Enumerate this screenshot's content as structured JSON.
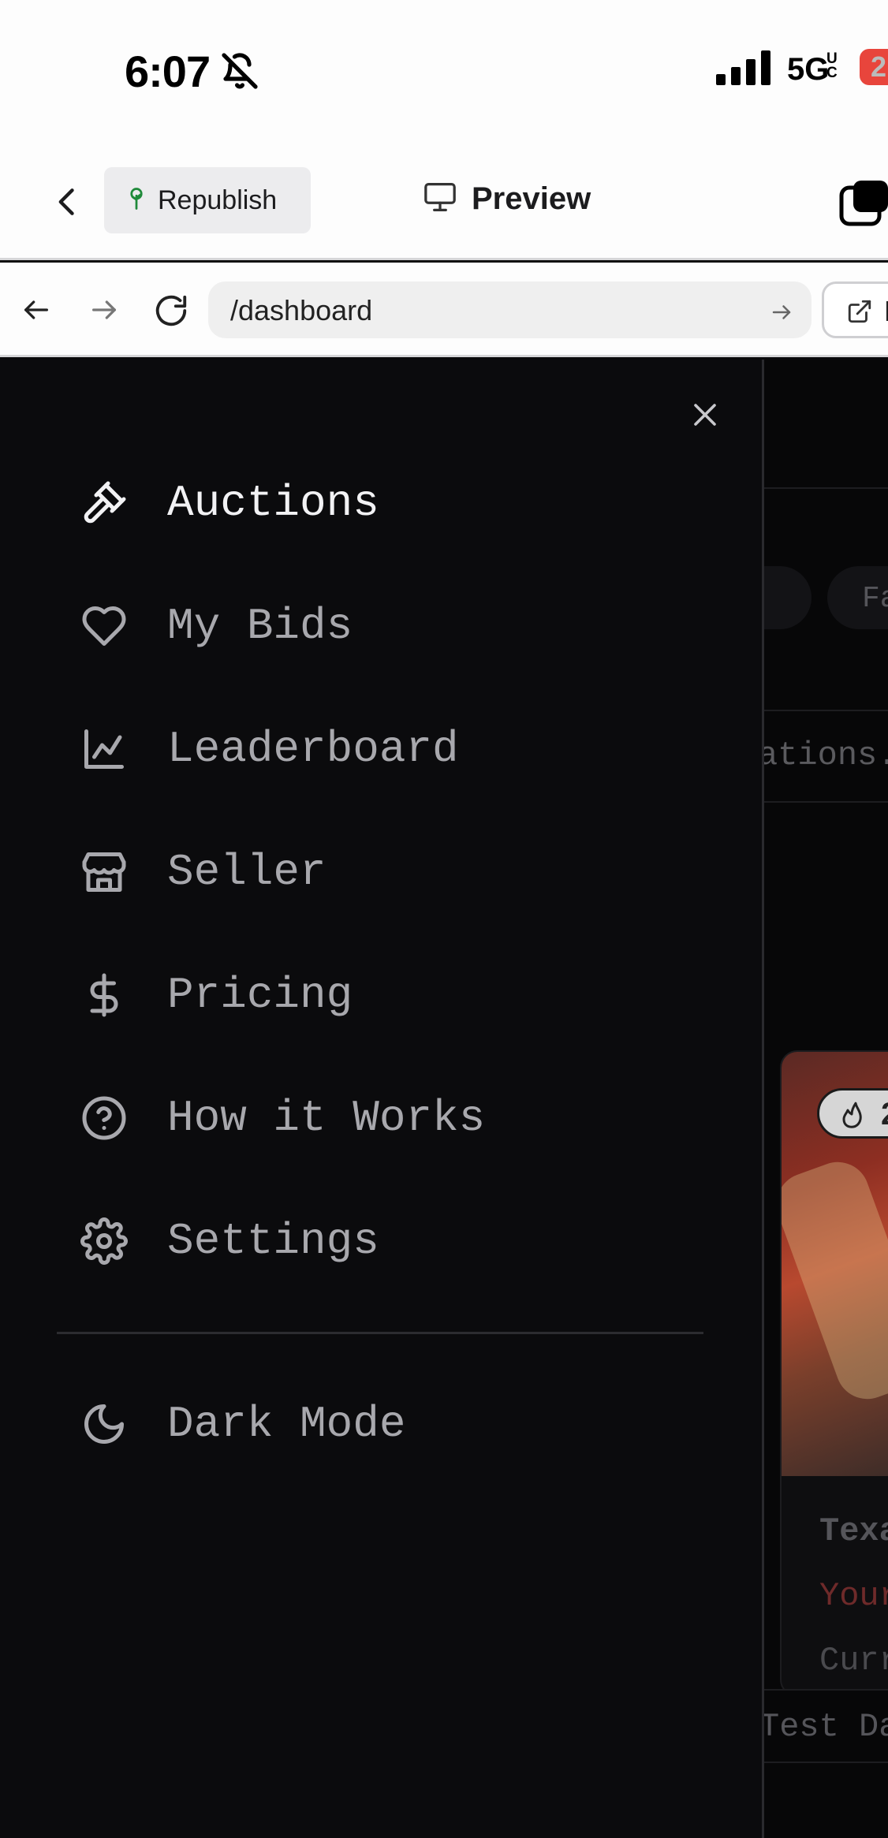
{
  "status_bar": {
    "time": "6:07",
    "network": "5G",
    "network_sup": "UC",
    "battery_level": "2",
    "icons": [
      "bell-slash-icon",
      "signal-icon"
    ]
  },
  "app_toolbar": {
    "republish_label": "Republish",
    "preview_label": "Preview",
    "icons": [
      "chevron-left-icon",
      "tree-icon",
      "monitor-icon",
      "tabs-icon"
    ]
  },
  "browser_bar": {
    "url": "/dashboard",
    "open_new_label": "N",
    "icons": [
      "arrow-left-icon",
      "arrow-right-icon",
      "reload-icon",
      "go-arrow-icon",
      "external-link-icon"
    ]
  },
  "drawer": {
    "items": [
      {
        "label": "Auctions",
        "icon": "gavel-icon",
        "active": true
      },
      {
        "label": "My Bids",
        "icon": "heart-icon",
        "active": false
      },
      {
        "label": "Leaderboard",
        "icon": "chart-line-icon",
        "active": false
      },
      {
        "label": "Seller",
        "icon": "store-icon",
        "active": false
      },
      {
        "label": "Pricing",
        "icon": "dollar-icon",
        "active": false
      },
      {
        "label": "How it Works",
        "icon": "help-circle-icon",
        "active": false
      },
      {
        "label": "Settings",
        "icon": "gear-icon",
        "active": false
      }
    ],
    "dark_mode": {
      "label": "Dark Mode",
      "icon": "moon-icon"
    }
  },
  "background_page": {
    "pill_text": "Fa",
    "search_text": "ations.",
    "badge_text": "2",
    "card_title": "Texa",
    "card_red_text": "Your",
    "card_gray_text": "Curr",
    "footer_text": "Test Da"
  },
  "colors": {
    "drawer_bg": "#0b0b0d",
    "active_text": "#f2f2f4",
    "inactive_text": "#a8a8ad",
    "battery": "#e8453c"
  }
}
